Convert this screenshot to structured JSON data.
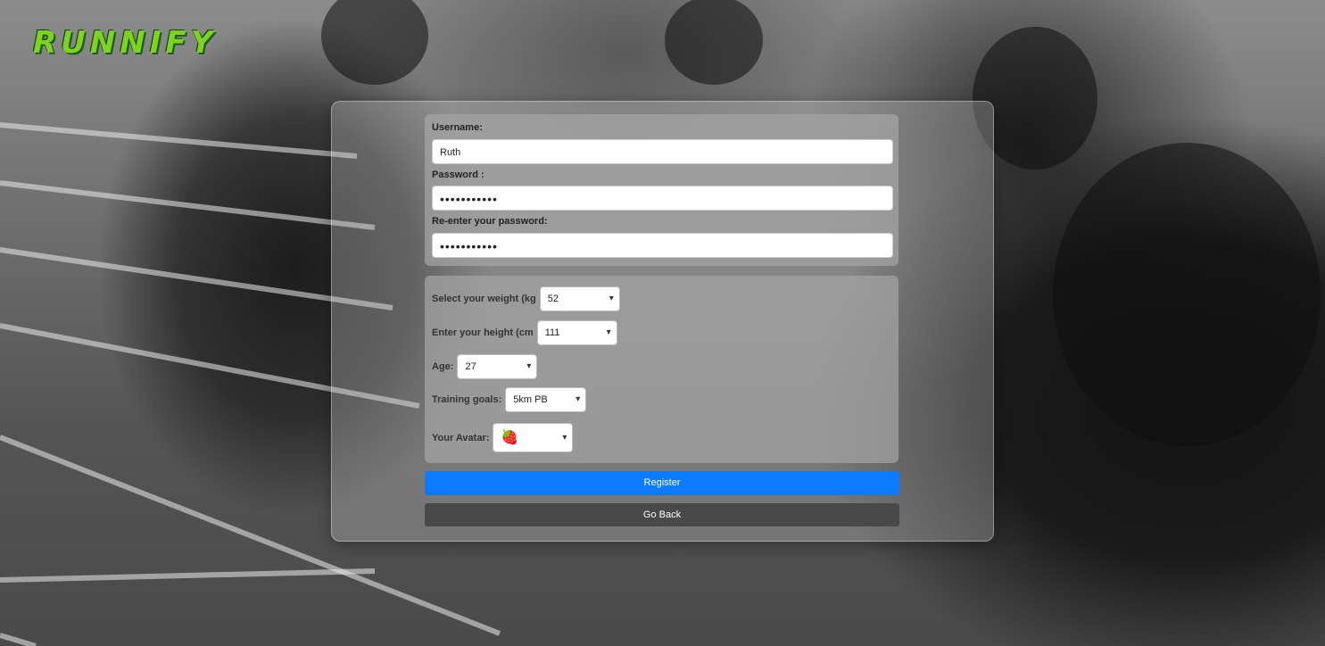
{
  "app": {
    "logo_text": "RUNNIFY"
  },
  "credentials": {
    "username_label": "Username:",
    "username_value": "Ruth",
    "password_label": "Password :",
    "password_value": "•••••••••••",
    "reenter_label": "Re-enter your password:",
    "reenter_value": "•••••••••••"
  },
  "profile": {
    "weight_label": "Select your weight (kg",
    "weight_value": "52",
    "height_label": "Enter your height (cm",
    "height_value": "111",
    "age_label": "Age:",
    "age_value": "27",
    "goals_label": "Training goals:",
    "goals_value": "5km PB",
    "avatar_label": "Your Avatar:",
    "avatar_value": "🍓"
  },
  "actions": {
    "register_label": "Register",
    "back_label": "Go Back"
  },
  "colors": {
    "register": "#0d7bff",
    "back": "#494949",
    "logo": "#7ed321"
  }
}
